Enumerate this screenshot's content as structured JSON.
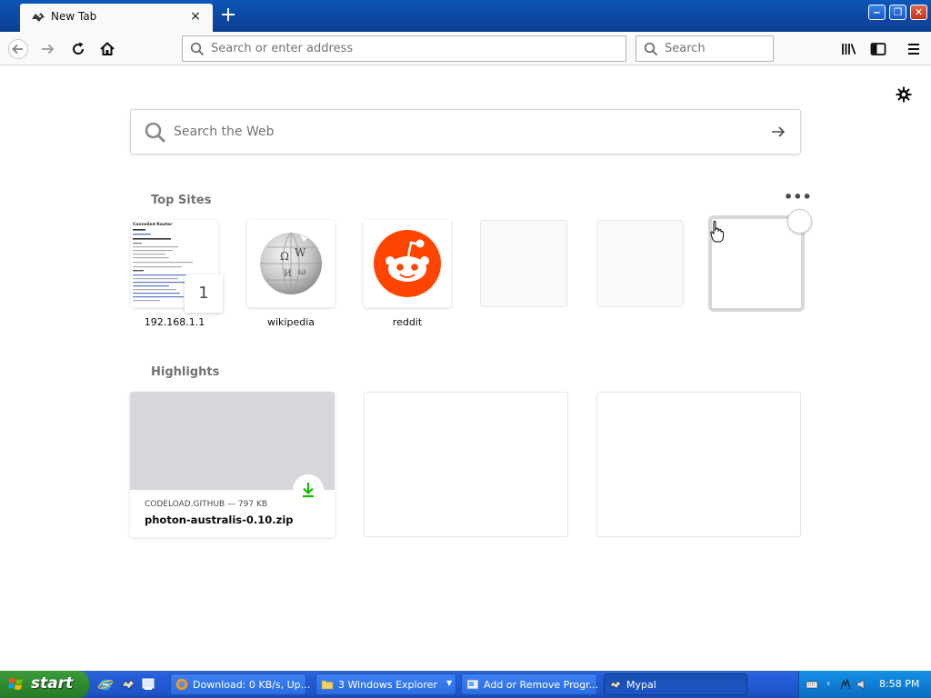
{
  "tab": {
    "title": "New Tab",
    "close_glyph": "×",
    "favicon": "mypal-icon"
  },
  "window_controls": {
    "minimize": "‒",
    "restore": "❐",
    "close": "✕"
  },
  "toolbar": {
    "url_placeholder": "Search or enter address",
    "search_placeholder": "Search"
  },
  "content": {
    "web_search_placeholder": "Search the Web",
    "top_sites_title": "Top Sites",
    "more_glyph": "•••",
    "top_sites": [
      {
        "label": "192.168.1.1",
        "badge": "1",
        "thumb_heading": "Conceiled Router"
      },
      {
        "label": "wikipedia"
      },
      {
        "label": "reddit"
      },
      {
        "label": ""
      },
      {
        "label": ""
      },
      {
        "label": ""
      }
    ],
    "highlights_title": "Highlights",
    "highlights": [
      {
        "host": "CODELOAD.GITHUB — 797 KB",
        "name": "photon-australis-0.10.zip"
      }
    ]
  },
  "taskbar": {
    "start_label": "start",
    "tasks": [
      {
        "label": "Download: 0 KB/s, Up...",
        "icon": "firefox-icon"
      },
      {
        "label": "3 Windows Explorer",
        "icon": "folder-icon"
      },
      {
        "label": "Add or Remove Progr...",
        "icon": "control-panel-icon"
      },
      {
        "label": "Mypal",
        "icon": "mypal-icon"
      }
    ],
    "clock": "8:58 PM"
  },
  "colors": {
    "reddit": "#ff4500",
    "download_green": "#12bc00",
    "taskbar_blue": "#245edb",
    "start_green": "#2f8a2f"
  }
}
